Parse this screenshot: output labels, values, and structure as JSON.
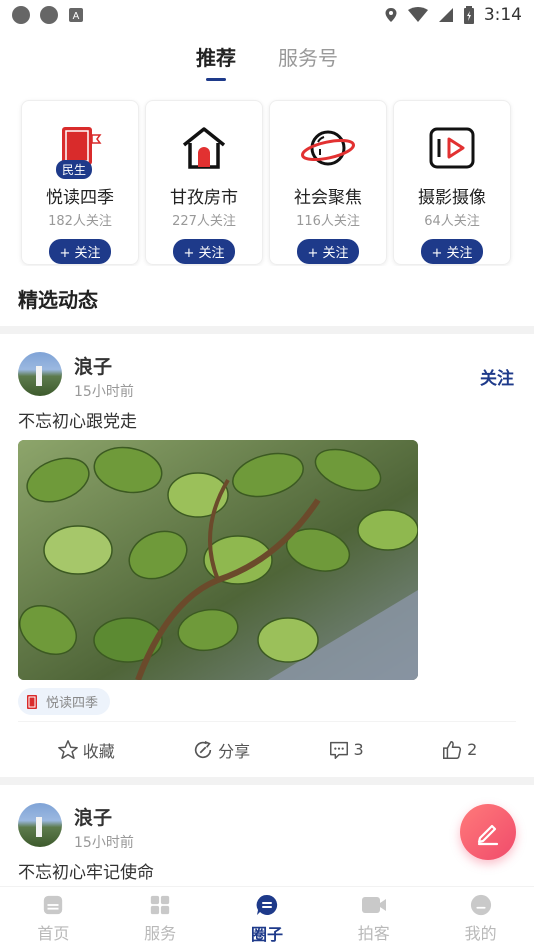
{
  "status_bar": {
    "time": "3:14"
  },
  "top_tabs": [
    {
      "label": "推荐",
      "active": true
    },
    {
      "label": "服务号",
      "active": false
    }
  ],
  "recommend_cards": [
    {
      "title": "悦读四季",
      "followers": "182人关注",
      "follow_label": "+ 关注",
      "badge": "民生",
      "icon": "book-icon"
    },
    {
      "title": "甘孜房市",
      "followers": "227人关注",
      "follow_label": "+ 关注",
      "icon": "house-icon"
    },
    {
      "title": "社会聚焦",
      "followers": "116人关注",
      "follow_label": "+ 关注",
      "icon": "planet-icon"
    },
    {
      "title": "摄影摄像",
      "followers": "64人关注",
      "follow_label": "+ 关注",
      "icon": "video-icon"
    }
  ],
  "section_title": "精选动态",
  "posts": [
    {
      "name": "浪子",
      "time": "15小时前",
      "follow_label": "关注",
      "text": "不忘初心跟党走",
      "tag": "悦读四季",
      "actions": {
        "collect": "收藏",
        "share": "分享",
        "comments": "3",
        "likes": "2"
      }
    },
    {
      "name": "浪子",
      "time": "15小时前",
      "text": "不忘初心牢记使命"
    }
  ],
  "bottom_nav": [
    {
      "label": "首页",
      "active": false
    },
    {
      "label": "服务",
      "active": false
    },
    {
      "label": "圈子",
      "active": true
    },
    {
      "label": "拍客",
      "active": false
    },
    {
      "label": "我的",
      "active": false
    }
  ],
  "colors": {
    "accent": "#1e3a8a",
    "fab": "#f04b6b"
  }
}
